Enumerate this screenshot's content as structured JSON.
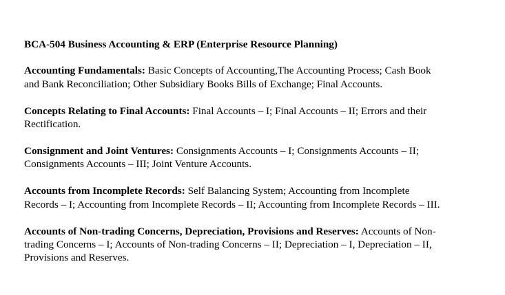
{
  "document": {
    "course_title": "BCA-504 Business Accounting & ERP (Enterprise Resource Planning)",
    "sections": [
      {
        "heading": "Accounting Fundamentals:",
        "line1": "Basic Concepts of Accounting,The Accounting Process; Cash Book",
        "line2": "and Bank Reconciliation; Other Subsidiary Books Bills of Exchange; Final Accounts.",
        "line3": ""
      },
      {
        "heading": "Concepts Relating to Final Accounts:",
        "line1": "Final Accounts – I; Final Accounts – II; Errors and their",
        "line2": "Rectification.",
        "line3": ""
      },
      {
        "heading": "Consignment and Joint Ventures:",
        "line1": "Consignments Accounts – I; Consignments Accounts – II;",
        "line2": "Consignments Accounts – III; Joint Venture Accounts.",
        "line3": ""
      },
      {
        "heading": "Accounts from Incomplete Records:",
        "line1": "Self Balancing System; Accounting from Incomplete",
        "line2": "Records – I; Accounting from Incomplete Records – II; Accounting from Incomplete Records – III.",
        "line3": ""
      },
      {
        "heading": "Accounts of Non-trading Concerns, Depreciation, Provisions and Reserves:",
        "line1": "Accounts of Non-",
        "line2": "trading Concerns – I; Accounts of Non-trading Concerns – II; Depreciation – I, Depreciation – II,",
        "line3": "Provisions and Reserves."
      }
    ]
  }
}
